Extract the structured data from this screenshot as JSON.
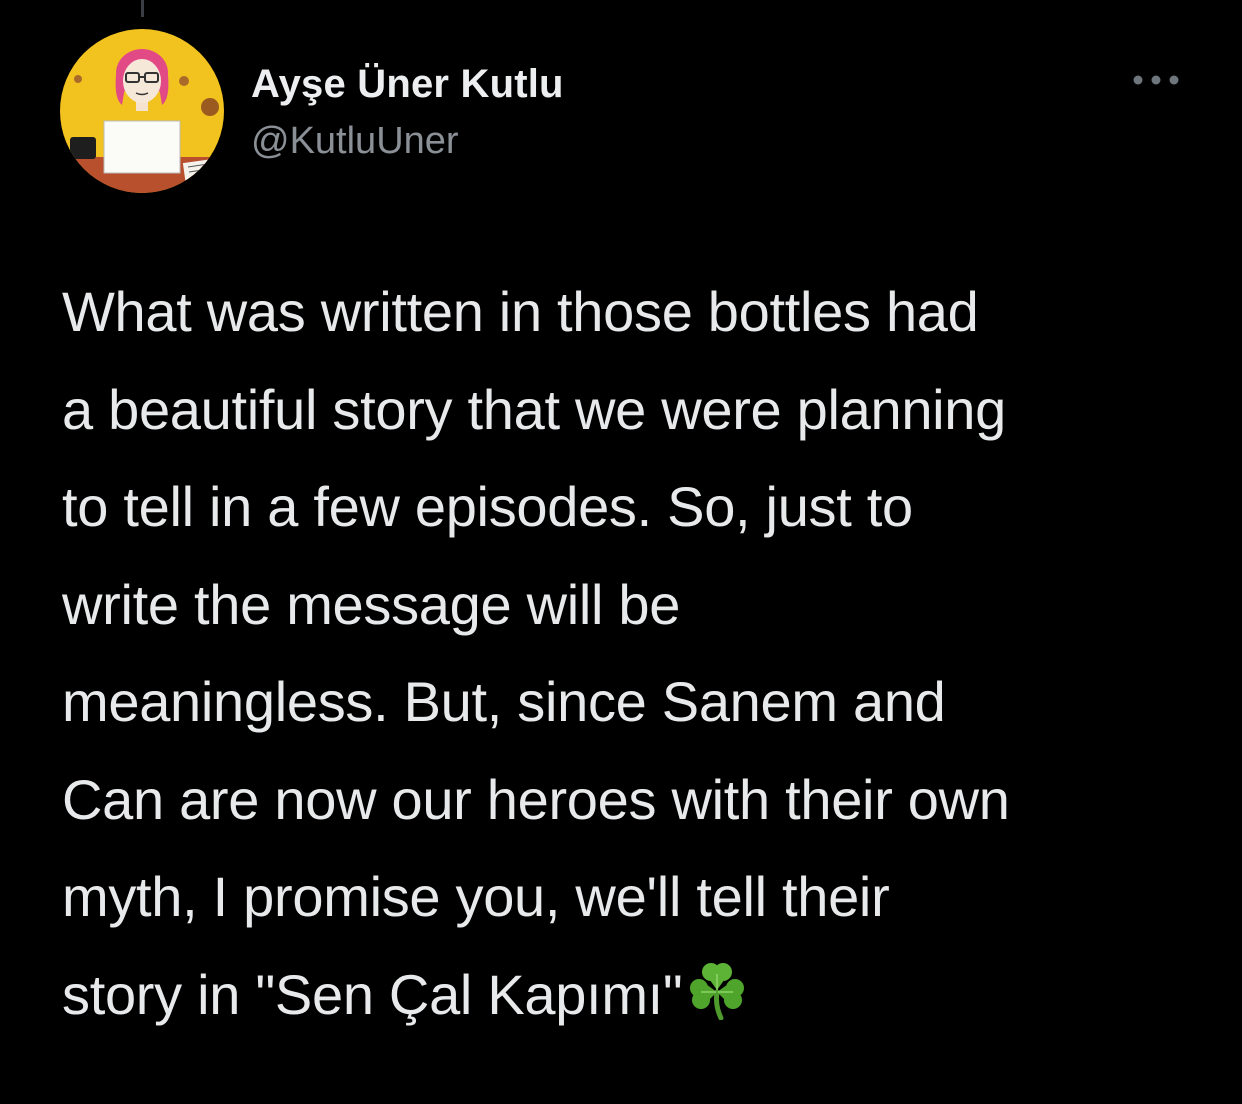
{
  "tweet": {
    "author": {
      "display_name": "Ayşe Üner Kutlu",
      "handle": "@KutluUner",
      "avatar_icon": "avatar-illustration"
    },
    "more_icon": "more-options-icon",
    "text_lines": [
      "What was written in those bottles had",
      "a beautiful story that we were planning",
      "to tell in a few episodes. So, just to",
      "write the message will be",
      "meaningless. But, since Sanem and",
      "Can are now our heroes with their own",
      "myth, I promise you, we'll tell their",
      "story in \"Sen Çal Kapımı\""
    ],
    "trailing_emoji": "shamrock-icon"
  },
  "colors": {
    "background": "#000000",
    "text_primary": "#e7e9ea",
    "text_secondary": "#8b9097",
    "avatar_yellow": "#f3c623"
  }
}
